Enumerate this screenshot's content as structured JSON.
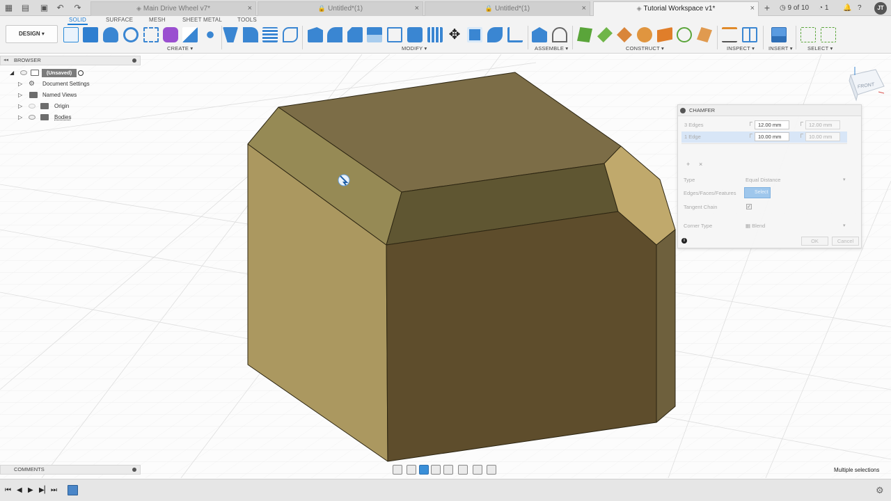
{
  "tabs": {
    "items": [
      {
        "label": "Main Drive Wheel v7*"
      },
      {
        "label": "Untitled*(1)"
      },
      {
        "label": "Untitled*(1)"
      },
      {
        "label": "Tutorial Workspace v1*"
      }
    ],
    "counter": "9 of 10",
    "notifications": "1",
    "user_initials": "JT"
  },
  "ribbon": {
    "workspace_tabs": [
      "SOLID",
      "SURFACE",
      "MESH",
      "SHEET METAL",
      "TOOLS"
    ],
    "design_label": "DESIGN",
    "groups": [
      "CREATE",
      "MODIFY",
      "ASSEMBLE",
      "CONSTRUCT",
      "INSPECT",
      "INSERT",
      "SELECT"
    ]
  },
  "browser": {
    "title": "BROWSER",
    "root": "(Unsaved)",
    "items": [
      "Document Settings",
      "Named Views",
      "Origin",
      "Bodies"
    ]
  },
  "comments": {
    "title": "COMMENTS"
  },
  "viewcube": {
    "face": "FRONT"
  },
  "chamfer": {
    "title": "CHAMFER",
    "rows": [
      {
        "label": "3 Edges",
        "distance": "12.00 mm",
        "distance2": "12.00 mm"
      },
      {
        "label": "1 Edge",
        "distance": "10.00 mm",
        "distance2": "10.00 mm"
      }
    ],
    "type_label": "Type",
    "type_value": "Equal Distance",
    "edges_label": "Edges/Faces/Features",
    "select_label": "Select",
    "tangent_label": "Tangent Chain",
    "corner_label": "Corner Type",
    "corner_value": "Blend",
    "ok": "OK",
    "cancel": "Cancel"
  },
  "status": {
    "selection": "Multiple selections"
  },
  "colors": {
    "accent": "#1a7bd4",
    "face_left": "#ab9860",
    "face_front": "#5e4d2c",
    "face_top": "#7c6d47"
  }
}
